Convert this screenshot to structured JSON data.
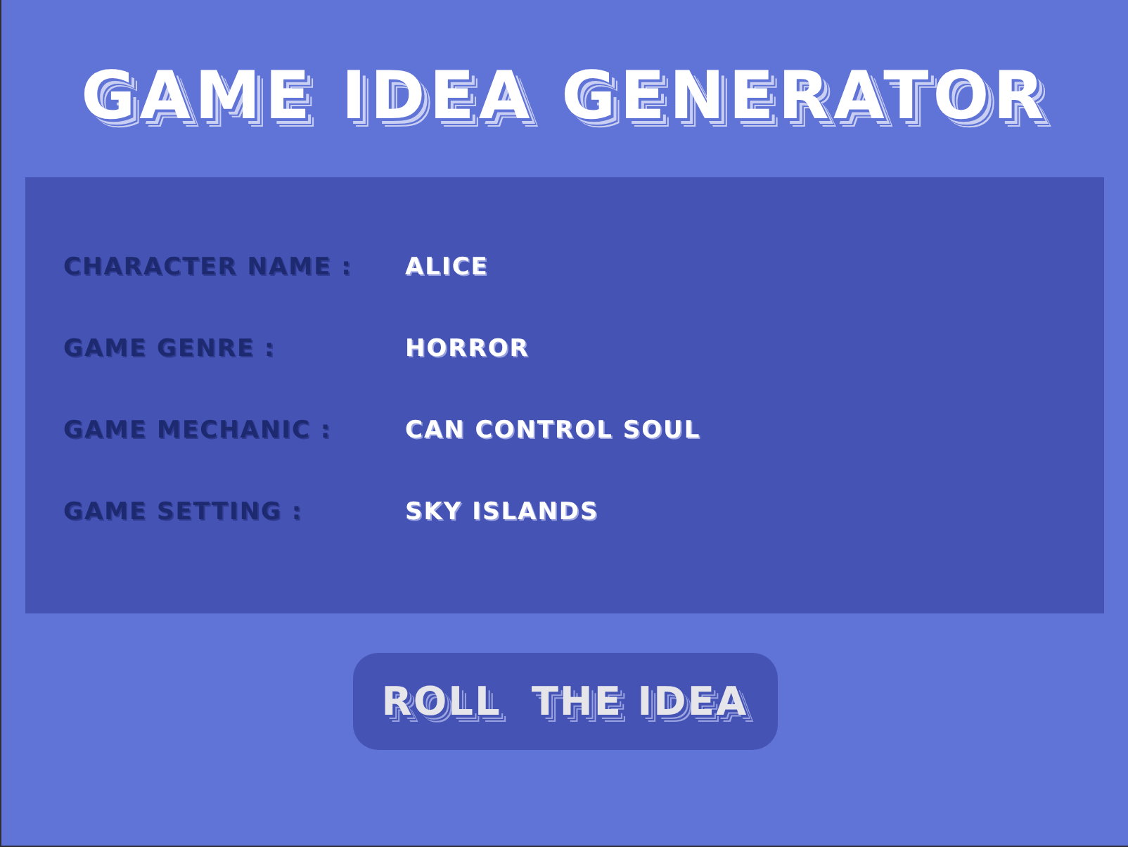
{
  "title": "GAME IDEA GENERATOR",
  "fields": [
    {
      "label": "CHARACTER NAME :",
      "value": "ALICE"
    },
    {
      "label": "GAME GENRE :",
      "value": "HORROR"
    },
    {
      "label": "GAME MECHANIC :",
      "value": "CAN CONTROL SOUL"
    },
    {
      "label": "GAME SETTING :",
      "value": "SKY ISLANDS"
    }
  ],
  "button": {
    "label": "ROLL  THE IDEA"
  }
}
